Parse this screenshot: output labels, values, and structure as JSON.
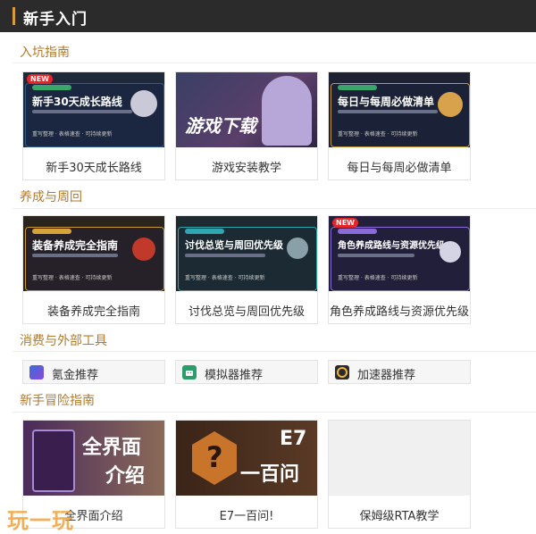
{
  "header": {
    "title": "新手入门"
  },
  "sections": [
    {
      "title": "入坑指南"
    },
    {
      "title": "养成与周回"
    },
    {
      "title": "消费与外部工具"
    },
    {
      "title": "新手冒险指南"
    }
  ],
  "guide_cards": [
    {
      "caption": "新手30天成长路线",
      "thumb_title": "新手30天成长路线",
      "badge": "NEW",
      "footer": "重写整理 · 表格速查 · 可持续更新"
    },
    {
      "caption": "游戏安装教学",
      "thumb_title": "游戏下载"
    },
    {
      "caption": "每日与每周必做清单",
      "thumb_title": "每日与每周必做清单",
      "footer": "重写整理 · 表格速查 · 可持续更新"
    }
  ],
  "growth_cards": [
    {
      "caption": "装备养成完全指南",
      "thumb_title": "装备养成完全指南",
      "footer": "重写整理 · 表格速查 · 可持续更新"
    },
    {
      "caption": "讨伐总览与周回优先级",
      "thumb_title": "讨伐总览与周回优先级",
      "footer": "重写整理 · 表格速查 · 可持续更新"
    },
    {
      "caption": "角色养成路线与资源优先级",
      "thumb_title": "角色养成路线与资源优先级",
      "badge": "NEW",
      "footer": "重写整理 · 表格速查 · 可持续更新"
    }
  ],
  "tools": [
    {
      "label": "氪金推荐",
      "icon": "gift-icon"
    },
    {
      "label": "模拟器推荐",
      "icon": "android-icon"
    },
    {
      "label": "加速器推荐",
      "icon": "accelerator-icon"
    }
  ],
  "adventure_cards": [
    {
      "caption": "全界面介绍",
      "thumb_title_1": "全界面",
      "thumb_title_2": "介绍"
    },
    {
      "caption": "E7一百问!",
      "thumb_title_1": "E7",
      "thumb_title_2": "一百问"
    },
    {
      "caption": "保姆级RTA教学"
    }
  ],
  "watermark": "玩一玩",
  "colors": {
    "accent": "#d89b3a",
    "section": "#b07a2c",
    "header_bg": "#2b2b2b"
  }
}
